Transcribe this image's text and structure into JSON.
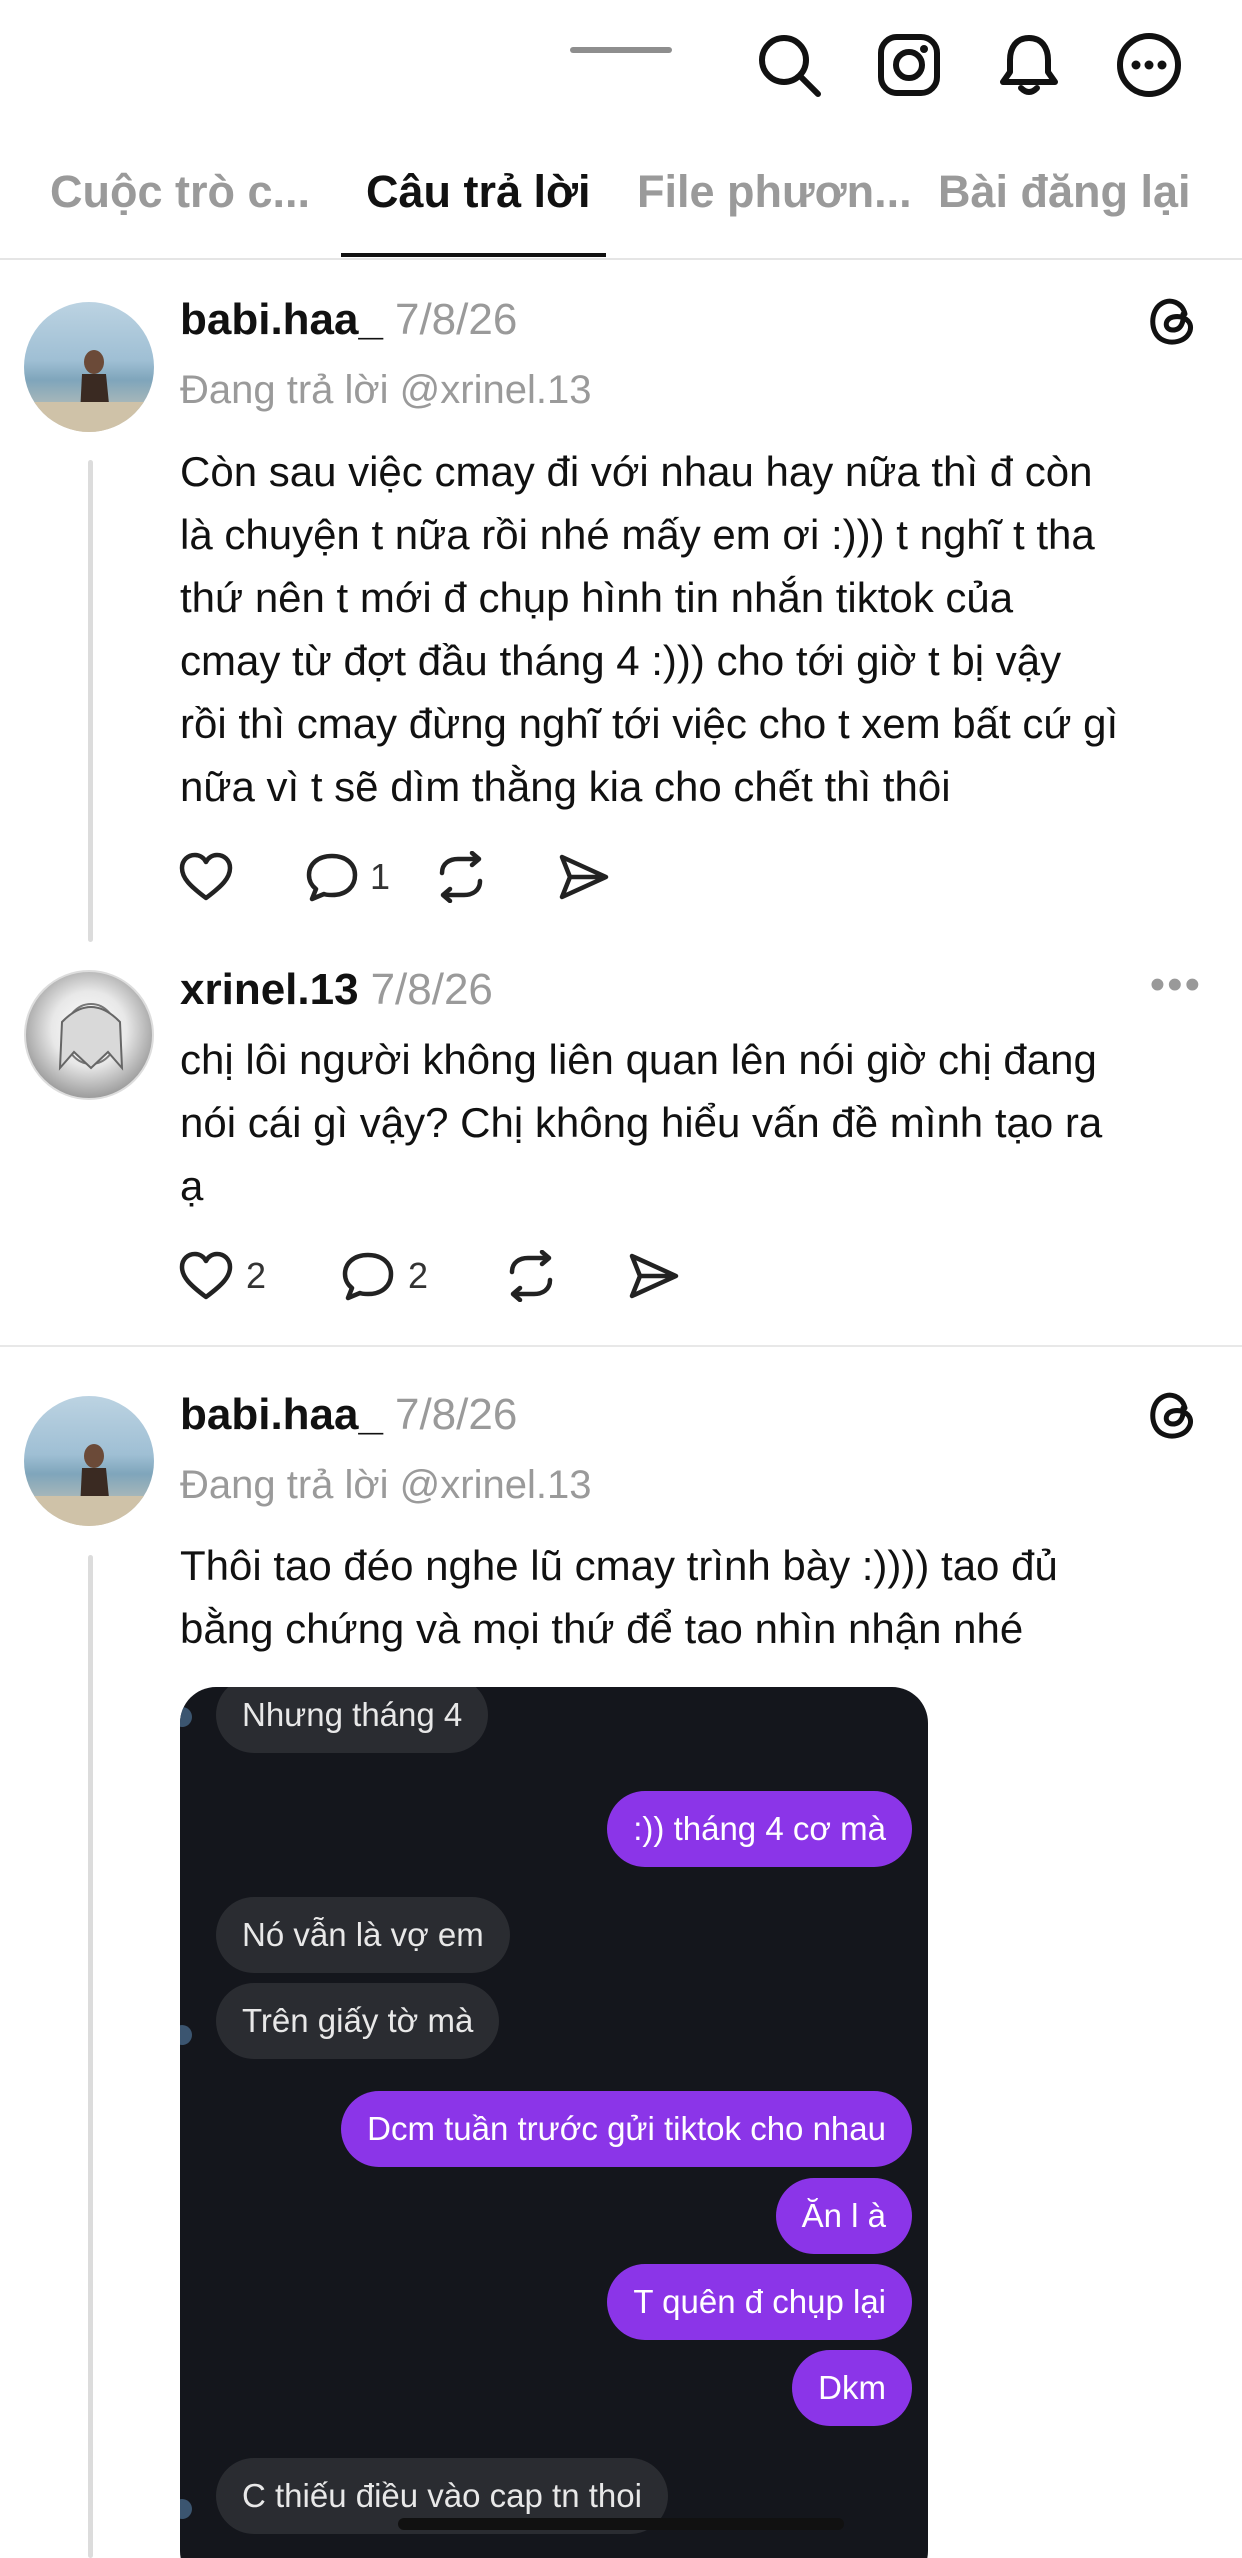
{
  "tabs": [
    {
      "label": "Cuộc trò c..."
    },
    {
      "label": "Câu trả lời"
    },
    {
      "label": "File phươn..."
    },
    {
      "label": "Bài đăng lại"
    }
  ],
  "posts": [
    {
      "username": "babi.haa_",
      "date": "7/8/26",
      "replying_to": "Đang trả lời @xrinel.13",
      "lines": [
        "Còn sau việc cmay đi với nhau hay nữa thì đ còn",
        "là chuyện t nữa rồi nhé mấy em ơi :))) t nghĩ t tha",
        "thứ nên t mới đ chụp hình tin nhắn tiktok của",
        "cmay từ đợt đầu tháng 4 :))) cho tới giờ t bị vậy",
        "rồi thì cmay đừng nghĩ tới việc cho t xem bất cứ gì",
        "nữa vì t sẽ dìm thằng kia cho chết thì thôi"
      ],
      "likes": "",
      "replies": "1"
    },
    {
      "username": "xrinel.13",
      "date": "7/8/26",
      "lines": [
        "chị lôi người không liên quan lên nói giờ chị đang",
        "nói cái gì vậy? Chị không hiểu vấn đề mình tạo ra",
        "ạ"
      ],
      "likes": "2",
      "replies": "2",
      "more_label": "•••"
    },
    {
      "username": "babi.haa_",
      "date": "7/8/26",
      "replying_to": "Đang trả lời @xrinel.13",
      "lines": [
        "Thôi tao đéo nghe lũ cmay trình bày :)))) tao đủ",
        "bằng chứng và mọi thứ để tao nhìn nhận nhé"
      ]
    }
  ],
  "chat": [
    {
      "text": "Nhưng tháng 4",
      "side": "in"
    },
    {
      "text": ":)) tháng 4 cơ mà",
      "side": "out"
    },
    {
      "text": "Nó vẫn là vợ em",
      "side": "in"
    },
    {
      "text": "Trên giấy tờ mà",
      "side": "in"
    },
    {
      "text": "Dcm tuần trước gửi tiktok cho nhau",
      "side": "out"
    },
    {
      "text": "Ăn l à",
      "side": "out"
    },
    {
      "text": "T quên đ chụp lại",
      "side": "out"
    },
    {
      "text": "Dkm",
      "side": "out"
    },
    {
      "text": "C thiếu điều vào cap tn thoi",
      "side": "in"
    }
  ],
  "colors": {
    "accent_purple": "#8b35e8",
    "muted_text": "#9a9a9a"
  }
}
